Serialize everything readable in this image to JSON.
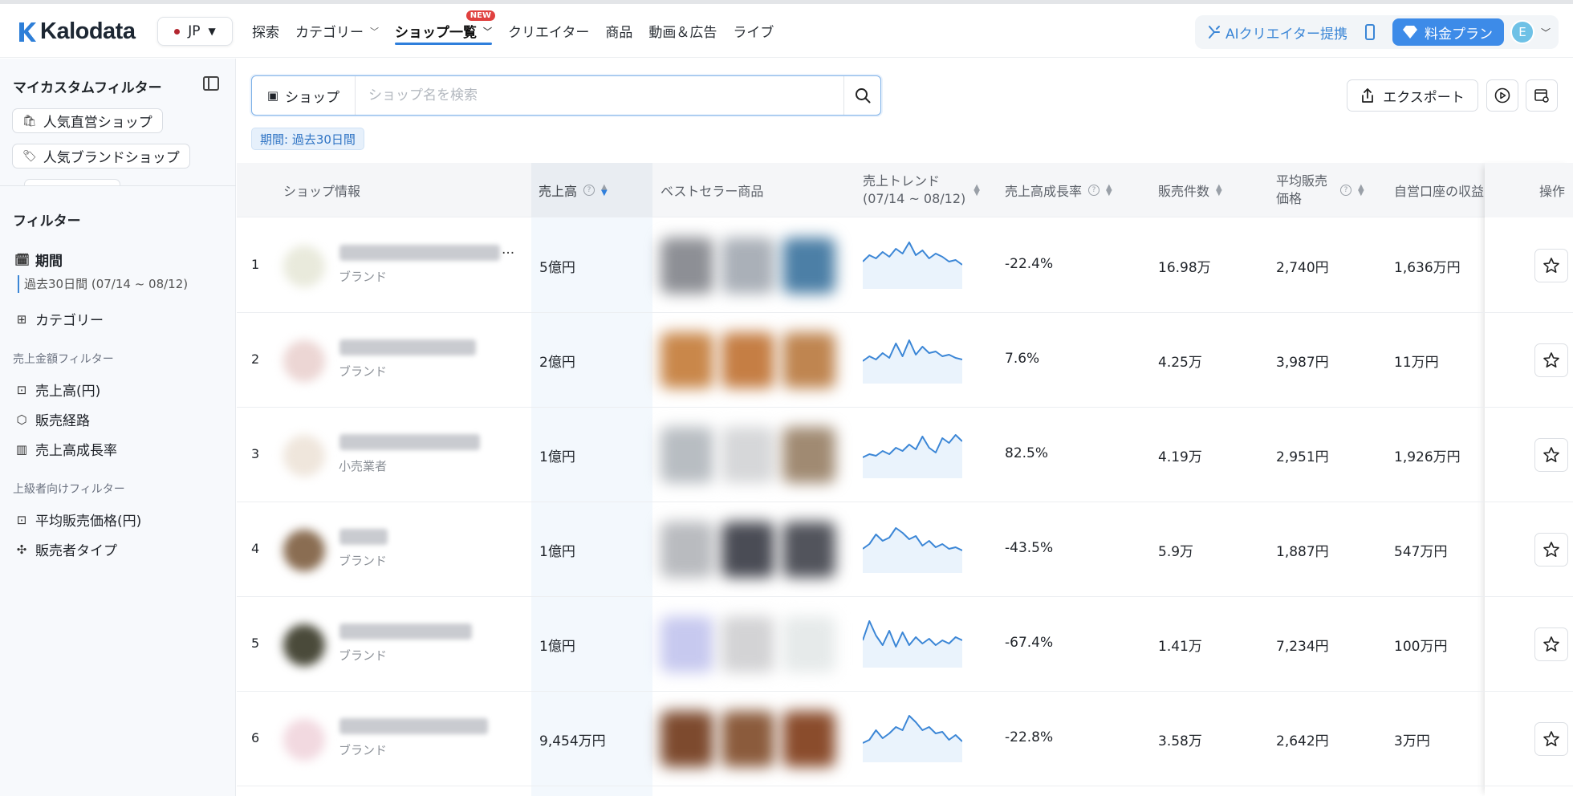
{
  "header": {
    "logo": "Kalodata",
    "region": "JP",
    "nav": [
      {
        "label": "探索"
      },
      {
        "label": "カテゴリー"
      },
      {
        "label": "ショップ一覧",
        "badge": "NEW"
      },
      {
        "label": "クリエイター"
      },
      {
        "label": "商品"
      },
      {
        "label": "動画＆広告"
      },
      {
        "label": "ライブ"
      }
    ],
    "ai_link": "AIクリエイター提携",
    "plan_button": "料金プラン",
    "avatar_letter": "E"
  },
  "sidebar": {
    "title": "マイカスタムフィルター",
    "chips": [
      "人気直営ショップ",
      "人気ブランドショップ"
    ],
    "filter_title": "フィルター",
    "period_label": "期間",
    "period_value": "過去30日間 (07/14 ~ 08/12)",
    "category_label": "カテゴリー",
    "group_sales": "売上金額フィルター",
    "sales_items": [
      "売上高(円)",
      "販売経路",
      "売上高成長率"
    ],
    "group_advanced": "上級者向けフィルター",
    "advanced_items": [
      "平均販売価格(円)",
      "販売者タイプ"
    ]
  },
  "search": {
    "type_label": "ショップ",
    "placeholder": "ショップ名を検索",
    "period_tag": "期間: 過去30日間",
    "export_label": "エクスポート"
  },
  "table": {
    "columns": {
      "shop_info": "ショップ情報",
      "sales": "売上高",
      "bestseller": "ベストセラー商品",
      "trend": "売上トレンド",
      "trend_range": "(07/14 ~ 08/12)",
      "growth": "売上高成長率",
      "units": "販売件数",
      "avg_price_1": "平均販売",
      "avg_price_2": "価格",
      "self_revenue": "自営口座の収益",
      "action": "操作"
    },
    "rows": [
      {
        "rank": "1",
        "type": "ブランド",
        "sales": "5億円",
        "growth": "-22.4%",
        "units": "16.98万",
        "avg_price": "2,740円",
        "self_revenue": "1,636万円"
      },
      {
        "rank": "2",
        "type": "ブランド",
        "sales": "2億円",
        "growth": "7.6%",
        "units": "4.25万",
        "avg_price": "3,987円",
        "self_revenue": "11万円"
      },
      {
        "rank": "3",
        "type": "小売業者",
        "sales": "1億円",
        "growth": "82.5%",
        "units": "4.19万",
        "avg_price": "2,951円",
        "self_revenue": "1,926万円"
      },
      {
        "rank": "4",
        "type": "ブランド",
        "sales": "1億円",
        "growth": "-43.5%",
        "units": "5.9万",
        "avg_price": "1,887円",
        "self_revenue": "547万円"
      },
      {
        "rank": "5",
        "type": "ブランド",
        "sales": "1億円",
        "growth": "-67.4%",
        "units": "1.41万",
        "avg_price": "7,234円",
        "self_revenue": "100万円"
      },
      {
        "rank": "6",
        "type": "ブランド",
        "sales": "9,454万円",
        "growth": "-22.8%",
        "units": "3.58万",
        "avg_price": "2,642円",
        "self_revenue": "3万円"
      }
    ]
  },
  "colors": {
    "accent": "#3d8be8",
    "trend_line": "#3b86d6",
    "new_badge": "#e0413f"
  }
}
